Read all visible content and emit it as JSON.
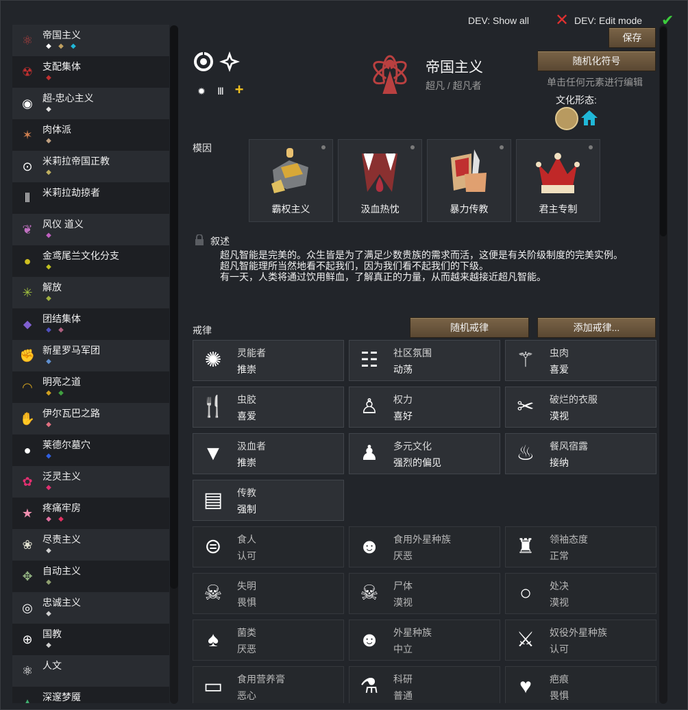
{
  "dev": {
    "show_all": "DEV: Show all",
    "edit_mode": "DEV: Edit mode"
  },
  "sidebar": {
    "items": [
      {
        "name": "帝国主义",
        "icon": "imperial-emblem-icon",
        "color": "#b04040"
      },
      {
        "name": "支配集体",
        "icon": "radiation-icon",
        "color": "#c03030"
      },
      {
        "name": "超-忠心主义",
        "icon": "eye-icon",
        "color": "#ffffff"
      },
      {
        "name": "肉体派",
        "icon": "star-burst-icon",
        "color": "#d08050"
      },
      {
        "name": "米莉拉帝国正教",
        "icon": "rings-icon",
        "color": "#ffffff"
      },
      {
        "name": "米莉拉劫掠者",
        "icon": "bars-icon",
        "color": "#ffffff"
      },
      {
        "name": "风仪 道义",
        "icon": "laurel-icon",
        "color": "#c070c0"
      },
      {
        "name": "金鸢尾兰文化分支",
        "icon": "yellow-orb-icon",
        "color": "#d0c020"
      },
      {
        "name": "解放",
        "icon": "burst-icon",
        "color": "#a0c040"
      },
      {
        "name": "团结集体",
        "icon": "drop-icon",
        "color": "#8060d0"
      },
      {
        "name": "新星罗马军团",
        "icon": "fist-icon",
        "color": "#60a0e0"
      },
      {
        "name": "明亮之道",
        "icon": "sun-fan-icon",
        "color": "#d0a020"
      },
      {
        "name": "伊尔瓦巴之路",
        "icon": "hand-icon",
        "color": "#e07080"
      },
      {
        "name": "莱德尔墓穴",
        "icon": "white-orb-icon",
        "color": "#ffffff"
      },
      {
        "name": "泛灵主义",
        "icon": "flower-icon",
        "color": "#e03070"
      },
      {
        "name": "疼痛牢房",
        "icon": "pink-star-icon",
        "color": "#f090b0"
      },
      {
        "name": "尽责主义",
        "icon": "lotus-icon",
        "color": "#e0e0d0"
      },
      {
        "name": "自动主义",
        "icon": "gear-cross-icon",
        "color": "#90b080"
      },
      {
        "name": "忠诚主义",
        "icon": "swirl-icon",
        "color": "#ffffff"
      },
      {
        "name": "国教",
        "icon": "globe-icon",
        "color": "#ffffff"
      },
      {
        "name": "人文",
        "icon": "atom-icon",
        "color": "#ffffff"
      },
      {
        "name": "深邃梦魇",
        "icon": "triangle-icon",
        "color": "#40b070"
      }
    ]
  },
  "header": {
    "save": "保存",
    "randomize_symbol": "随机化符号",
    "title": "帝国主义",
    "subtitle": "超凡 / 超凡者",
    "edit_hint": "单击任何元素进行编辑",
    "culture_label": "文化形态:"
  },
  "memes": {
    "label": "模因",
    "items": [
      {
        "name": "霸权主义",
        "icon": "hands-grip-icon"
      },
      {
        "name": "汲血热忱",
        "icon": "fangs-blood-icon"
      },
      {
        "name": "暴力传教",
        "icon": "dagger-book-icon"
      },
      {
        "name": "君主专制",
        "icon": "crown-icon"
      }
    ]
  },
  "narrative": {
    "label": "叙述",
    "lines": [
      "超凡智能是完美的。众生皆是为了满足少数贵族的需求而活，这便是有关阶级制度的完美实例。",
      "超凡智能理所当然地看不起我们，因为我们看不起我们的下级。",
      "有一天，人类将通过饮用鲜血，了解真正的力量，从而越来越接近超凡智能。"
    ]
  },
  "precepts": {
    "label": "戒律",
    "random_button": "随机戒律",
    "add_button": "添加戒律...",
    "items": [
      {
        "name": "灵能者",
        "value": "推崇",
        "icon": "psychic-icon",
        "dim": false
      },
      {
        "name": "社区氛围",
        "value": "动荡",
        "icon": "chat-people-icon",
        "dim": false
      },
      {
        "name": "虫肉",
        "value": "喜爱",
        "icon": "insect-icon",
        "dim": false
      },
      {
        "name": "虫胶",
        "value": "喜爱",
        "icon": "jelly-fork-icon",
        "dim": false
      },
      {
        "name": "权力",
        "value": "喜好",
        "icon": "kneel-icon",
        "dim": false
      },
      {
        "name": "破烂的衣服",
        "value": "漠视",
        "icon": "torn-clothes-icon",
        "dim": false
      },
      {
        "name": "汲血者",
        "value": "推崇",
        "icon": "fang-drop-icon",
        "dim": false
      },
      {
        "name": "多元文化",
        "value": "强烈的偏见",
        "icon": "crowd-icon",
        "dim": false
      },
      {
        "name": "餐风宿露",
        "value": "接纳",
        "icon": "campfire-icon",
        "dim": false
      },
      {
        "name": "传教",
        "value": "强制",
        "icon": "preach-icon",
        "dim": false
      },
      {
        "name": "食人",
        "value": "认可",
        "icon": "teeth-icon",
        "dim": true
      },
      {
        "name": "食用外星种族",
        "value": "厌恶",
        "icon": "alien-fork-icon",
        "dim": true
      },
      {
        "name": "领袖态度",
        "value": "正常",
        "icon": "leader-icon",
        "dim": true
      },
      {
        "name": "失明",
        "value": "畏惧",
        "icon": "skull-icon",
        "dim": true
      },
      {
        "name": "尸体",
        "value": "漠视",
        "icon": "corpse-icon",
        "dim": true
      },
      {
        "name": "处决",
        "value": "漠视",
        "icon": "noose-icon",
        "dim": true
      },
      {
        "name": "菌类",
        "value": "厌恶",
        "icon": "mushroom-icon",
        "dim": true
      },
      {
        "name": "外星种族",
        "value": "中立",
        "icon": "alien-icon",
        "dim": true
      },
      {
        "name": "奴役外星种族",
        "value": "认可",
        "icon": "slaves-icon",
        "dim": true
      },
      {
        "name": "食用营养膏",
        "value": "恶心",
        "icon": "paste-icon",
        "dim": true
      },
      {
        "name": "科研",
        "value": "普通",
        "icon": "flask-icon",
        "dim": true
      },
      {
        "name": "疤痕",
        "value": "畏惧",
        "icon": "scar-heart-icon",
        "dim": true
      }
    ]
  }
}
